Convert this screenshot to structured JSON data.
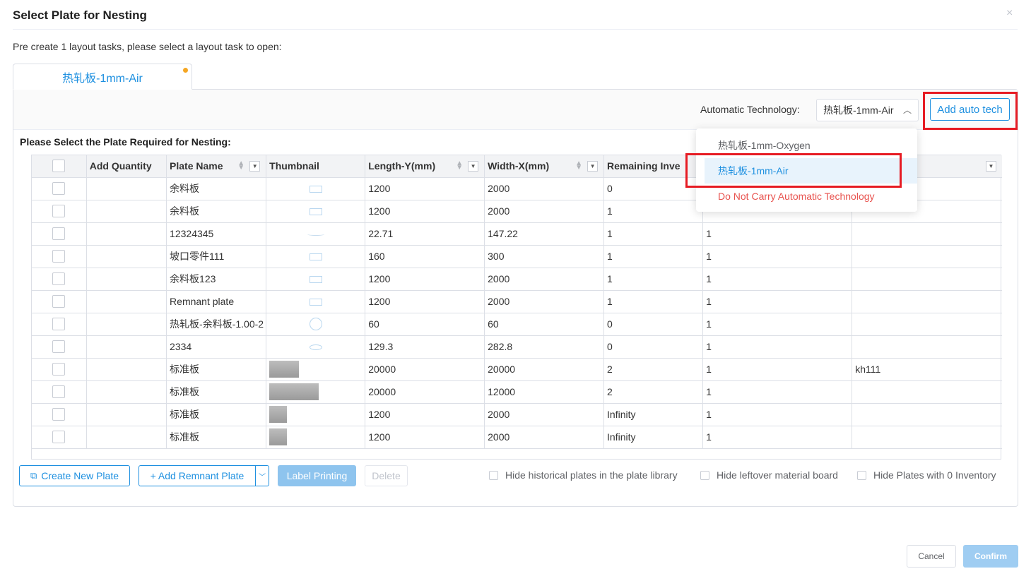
{
  "dialog": {
    "title": "Select Plate for Nesting",
    "close_label": "×",
    "intro": "Pre create 1 layout tasks, please select a layout task to open:"
  },
  "tab": {
    "label": "热轧板-1mm-Air"
  },
  "tech": {
    "label": "Automatic Technology:",
    "selected": "热轧板-1mm-Air",
    "add_button": "Add auto tech",
    "options": [
      "热轧板-1mm-Oxygen",
      "热轧板-1mm-Air",
      "Do Not Carry Automatic Technology"
    ]
  },
  "table": {
    "section_label": "Please Select the Plate Required for Nesting:",
    "headers": [
      "Add Quantity",
      "Plate Name",
      "Thumbnail",
      "Length-Y(mm)",
      "Width-X(mm)",
      "Remaining Inve",
      "",
      ""
    ],
    "rows": [
      {
        "name": "余料板",
        "thumb": "rect",
        "length": "1200",
        "width": "2000",
        "remaining": "0",
        "col6": "",
        "col7": ""
      },
      {
        "name": "余料板",
        "thumb": "rect",
        "length": "1200",
        "width": "2000",
        "remaining": "1",
        "col6": "",
        "col7": ""
      },
      {
        "name": "12324345",
        "thumb": "line",
        "length": "22.71",
        "width": "147.22",
        "remaining": "1",
        "col6": "1",
        "col7": ""
      },
      {
        "name": "坡口零件111",
        "thumb": "rect",
        "length": "160",
        "width": "300",
        "remaining": "1",
        "col6": "1",
        "col7": ""
      },
      {
        "name": "余料板123",
        "thumb": "rect",
        "length": "1200",
        "width": "2000",
        "remaining": "1",
        "col6": "1",
        "col7": ""
      },
      {
        "name": "Remnant plate",
        "thumb": "rect",
        "length": "1200",
        "width": "2000",
        "remaining": "1",
        "col6": "1",
        "col7": ""
      },
      {
        "name": "热轧板-余料板-1.00-2",
        "thumb": "circle",
        "length": "60",
        "width": "60",
        "remaining": "0",
        "col6": "1",
        "col7": ""
      },
      {
        "name": "2334",
        "thumb": "lens",
        "length": "129.3",
        "width": "282.8",
        "remaining": "0",
        "col6": "1",
        "col7": ""
      },
      {
        "name": "标准板",
        "thumb": "gray-42",
        "length": "20000",
        "width": "20000",
        "remaining": "2",
        "col6": "1",
        "col7": "kh111"
      },
      {
        "name": "标准板",
        "thumb": "gray-70",
        "length": "20000",
        "width": "12000",
        "remaining": "2",
        "col6": "1",
        "col7": ""
      },
      {
        "name": "标准板",
        "thumb": "gray-25",
        "length": "1200",
        "width": "2000",
        "remaining": "Infinity",
        "col6": "1",
        "col7": ""
      },
      {
        "name": "标准板",
        "thumb": "gray-25",
        "length": "1200",
        "width": "2000",
        "remaining": "Infinity",
        "col6": "1",
        "col7": ""
      }
    ]
  },
  "actions": {
    "create_new_plate": "Create New Plate",
    "add_remnant_plate": "+ Add Remnant Plate",
    "label_printing": "Label Printing",
    "delete": "Delete",
    "hide_historical": "Hide historical plates in the plate library",
    "hide_leftover": "Hide leftover material board",
    "hide_zero_inventory": "Hide Plates with 0 Inventory"
  },
  "footer": {
    "cancel": "Cancel",
    "confirm": "Confirm"
  },
  "colors": {
    "accent": "#1e90e0",
    "highlight": "#e61b23",
    "danger": "#e8534f",
    "tab_dot": "#f5a623"
  }
}
